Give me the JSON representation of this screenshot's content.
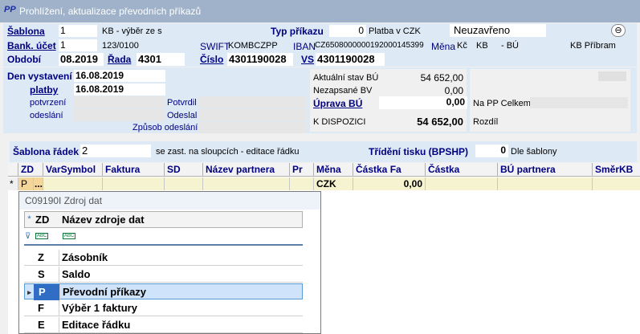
{
  "window": {
    "app_icon": "PP",
    "title": "Prohlížení, aktualizace převodních příkazů"
  },
  "header": {
    "sablona_label": "Šablona",
    "sablona_value": "1",
    "sablona_desc": "KB -  výběr ze s",
    "typ_label": "Typ příkazu",
    "typ_value": "0",
    "typ_desc": "Platba v CZK",
    "status": "Neuzavřeno",
    "bank_label": "Bank. účet",
    "bank_value": "1",
    "bank_account": "123/0100",
    "swift_label": "SWIFT",
    "swift_value": "KOMBCZPP",
    "iban_label": "IBAN",
    "iban_value": "CZ6508000000192000145399",
    "mena_label": "Měna",
    "mena_value": "Kč",
    "mena_bank": "KB",
    "bu_label": "- BÚ",
    "bank_branch": "KB Příbram",
    "obdobi_label": "Období",
    "obdobi_value": "08.2019",
    "rada_label": "Řada",
    "rada_value": "4301",
    "cislo_label": "Číslo",
    "cislo_value": "4301190028",
    "vs_label": "VS",
    "vs_value": "4301190028"
  },
  "dates": {
    "den_label": "Den vystavení",
    "den_value": "16.08.2019",
    "platby_label": "platby",
    "platby_value": "16.08.2019",
    "potvrzeni_label": "potvrzení",
    "odeslani_label": "odeslání",
    "potvrdil_label": "Potvrdil",
    "odeslal_label": "Odeslal",
    "zpusob_label": "Způsob odeslání"
  },
  "summary": {
    "aktualni_label": "Aktuální stav BÚ",
    "aktualni_value": "54 652,00",
    "nezapsane_label": "Nezapsané BV",
    "nezapsane_value": "0,00",
    "oprava_label": "Úprava BÚ",
    "oprava_value": "0,00",
    "pp_celkem_label": "Na PP Celkem",
    "dispozici_label": "K DISPOZICI",
    "dispozici_value": "54 652,00",
    "rozdil_label": "Rozdíl"
  },
  "rowbar": {
    "sablona_radek_label": "Šablona řádek",
    "sablona_radek_value": "2",
    "sablona_radek_desc": "se zast. na sloupcích - editace řádku",
    "trideni_label": "Třídění tisku (BPSHP)",
    "trideni_value": "0",
    "trideni_desc": "Dle šablony"
  },
  "grid": {
    "columns": [
      "ZD",
      "VarSymbol",
      "Faktura",
      "SD",
      "Název partnera",
      "Pr",
      "Měna",
      "Částka Fa",
      "Částka",
      "BÚ partnera",
      "SměrKB"
    ],
    "row": {
      "marker": "*",
      "zd": "P",
      "ellipsis": "...",
      "mena": "CZK",
      "castka_fa": "0,00"
    }
  },
  "popup": {
    "title": "C09190I Zdroj dat",
    "header_marker": "*",
    "col_zd": "ZD",
    "col_name": "Název zdroje dat",
    "filter_icon": "filter-icon",
    "filter_zd": "ABC",
    "filter_name": "ABC",
    "current_marker": "▸",
    "items": [
      {
        "code": "Z",
        "name": "Zásobník"
      },
      {
        "code": "S",
        "name": "Saldo"
      },
      {
        "code": "P",
        "name": "Převodní příkazy"
      },
      {
        "code": "F",
        "name": "Výběr 1 faktury"
      },
      {
        "code": "E",
        "name": "Editace řádku"
      }
    ]
  }
}
